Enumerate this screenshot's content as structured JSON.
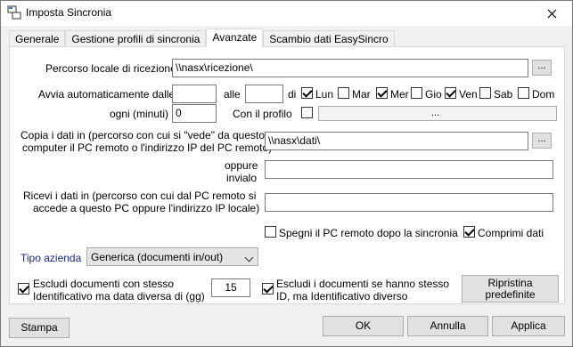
{
  "window": {
    "title": "Imposta Sincronia"
  },
  "tabs": [
    {
      "label": "Generale"
    },
    {
      "label": "Gestione profili di sincronia"
    },
    {
      "label": "Avanzate"
    },
    {
      "label": "Scambio dati EasySincro"
    }
  ],
  "local_path": {
    "label": "Percorso locale di ricezione",
    "value": "\\\\nasx\\ricezione\\",
    "browse": "..."
  },
  "auto_start": {
    "label_from": "Avvia automaticamente dalle",
    "from_value": "",
    "label_to": "alle",
    "to_value": "",
    "label_days": "di",
    "label_every": "ogni (minuti)",
    "every_value": "0",
    "label_profile": "Con il profilo",
    "profile_browse": "...",
    "days": [
      {
        "label": "Lun",
        "checked": true
      },
      {
        "label": "Mar",
        "checked": false
      },
      {
        "label": "Mer",
        "checked": true
      },
      {
        "label": "Gio",
        "checked": false
      },
      {
        "label": "Ven",
        "checked": true
      },
      {
        "label": "Sab",
        "checked": false
      },
      {
        "label": "Dom",
        "checked": false
      }
    ]
  },
  "copy_to": {
    "label_line1": "Copia i dati in (percorso con cui si \"vede\" da questo",
    "label_line2": "computer il PC remoto o l'indirizzo IP del PC remoto)",
    "value": "\\\\nasx\\dati\\",
    "browse": "...",
    "send_label_line1": "oppure",
    "send_label_line2": "invialo",
    "send_value": ""
  },
  "receive": {
    "label_line1": "Ricevi i dati in (percorso con cui dal PC remoto si",
    "label_line2": "accede a questo PC oppure l'indirizzo IP locale)",
    "value": ""
  },
  "options": {
    "shutdown_label": "Spegni il PC remoto dopo la sincronia",
    "shutdown_checked": false,
    "compress_label": "Comprimi dati",
    "compress_checked": true
  },
  "company_type": {
    "label": "Tipo azienda",
    "value": "Generica (documenti in/out)"
  },
  "exclude_date": {
    "label_line1": "Escludi documenti con stesso",
    "label_line2": "Identificativo ma data diversa di (gg)",
    "checked": true,
    "days_value": "15"
  },
  "exclude_id": {
    "label_line1": "Escludi i documenti se hanno stesso",
    "label_line2": "ID, ma Identificativo diverso",
    "checked": true
  },
  "restore_button": {
    "line1": "Ripristina",
    "line2": "predefinite"
  },
  "footer": {
    "print_label": "Stampa",
    "ok_label": "OK",
    "cancel_label": "Annulla",
    "apply_label": "Applica"
  },
  "colors": {
    "link_label": "#1a2a8a",
    "panel": "#ffffff",
    "frame": "#f0f0f0"
  }
}
